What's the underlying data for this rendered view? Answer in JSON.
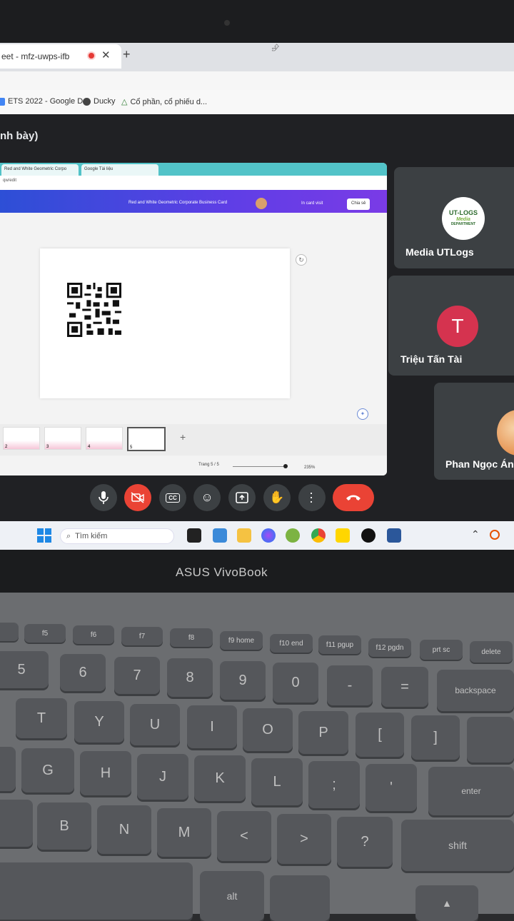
{
  "browser": {
    "tab_title": "eet - mfz-uwps-ifb",
    "tab_close": "✕",
    "new_tab": "+",
    "bookmarks": [
      {
        "label": "ETS 2022 - Google D...",
        "icon": "google-docs-icon",
        "color": "#f4b400"
      },
      {
        "label": "Ducky",
        "icon": "duck-icon",
        "color": "#444444"
      },
      {
        "label": "Cổ phần, cổ phiếu d...",
        "icon": "triangle-icon",
        "color": "#2e7d32"
      }
    ]
  },
  "meet": {
    "title": "nh bày)",
    "shared_screen": {
      "tab1": "Red and White Geometric Corpo",
      "tab2": "Google Tài liệu",
      "address": "qw/edit",
      "doc_title": "Red and White Geometric Corporate Business Card",
      "print_btn": "In card visit",
      "share_btn": "Chia sẻ",
      "page_indicator": "Trang 5 / 5",
      "zoom": "235%",
      "thumb_numbers": [
        "2",
        "3",
        "4",
        "5"
      ]
    },
    "participants": [
      {
        "name": "Media UTLogs",
        "avatar_text": "UT-LOGS",
        "avatar_sub": "Media",
        "avatar_sub2": "DEPARTMENT"
      },
      {
        "name": "Triệu Tấn Tài",
        "avatar_letter": "T"
      },
      {
        "name": "Phan Ngọc Án"
      }
    ],
    "controls": [
      "mic-icon",
      "camera-off-icon",
      "captions-icon",
      "emoji-icon",
      "present-icon",
      "raise-hand-icon",
      "more-icon",
      "leave-call-icon"
    ],
    "accent_red": "#ea4335"
  },
  "taskbar": {
    "search_placeholder": "Tìm kiếm"
  },
  "laptop": {
    "brand": "ASUS VivoBook",
    "fn_keys": [
      "f5",
      "f6",
      "f7",
      "f8",
      "f9 home",
      "f10 end",
      "f11 pgup",
      "f12 pgdn",
      "prt sc",
      "delete"
    ],
    "number_row": [
      "5",
      "6",
      "7",
      "8",
      "9",
      "0",
      "-",
      "=",
      "backspace"
    ],
    "top_row": [
      "T",
      "Y",
      "U",
      "I",
      "O",
      "P",
      "[",
      "]"
    ],
    "home_row": [
      "G",
      "H",
      "J",
      "K",
      "L",
      ";",
      "'",
      "enter"
    ],
    "bottom_row": [
      "B",
      "N",
      "M",
      "<",
      ">",
      "?",
      "shift"
    ],
    "alt": "alt"
  }
}
